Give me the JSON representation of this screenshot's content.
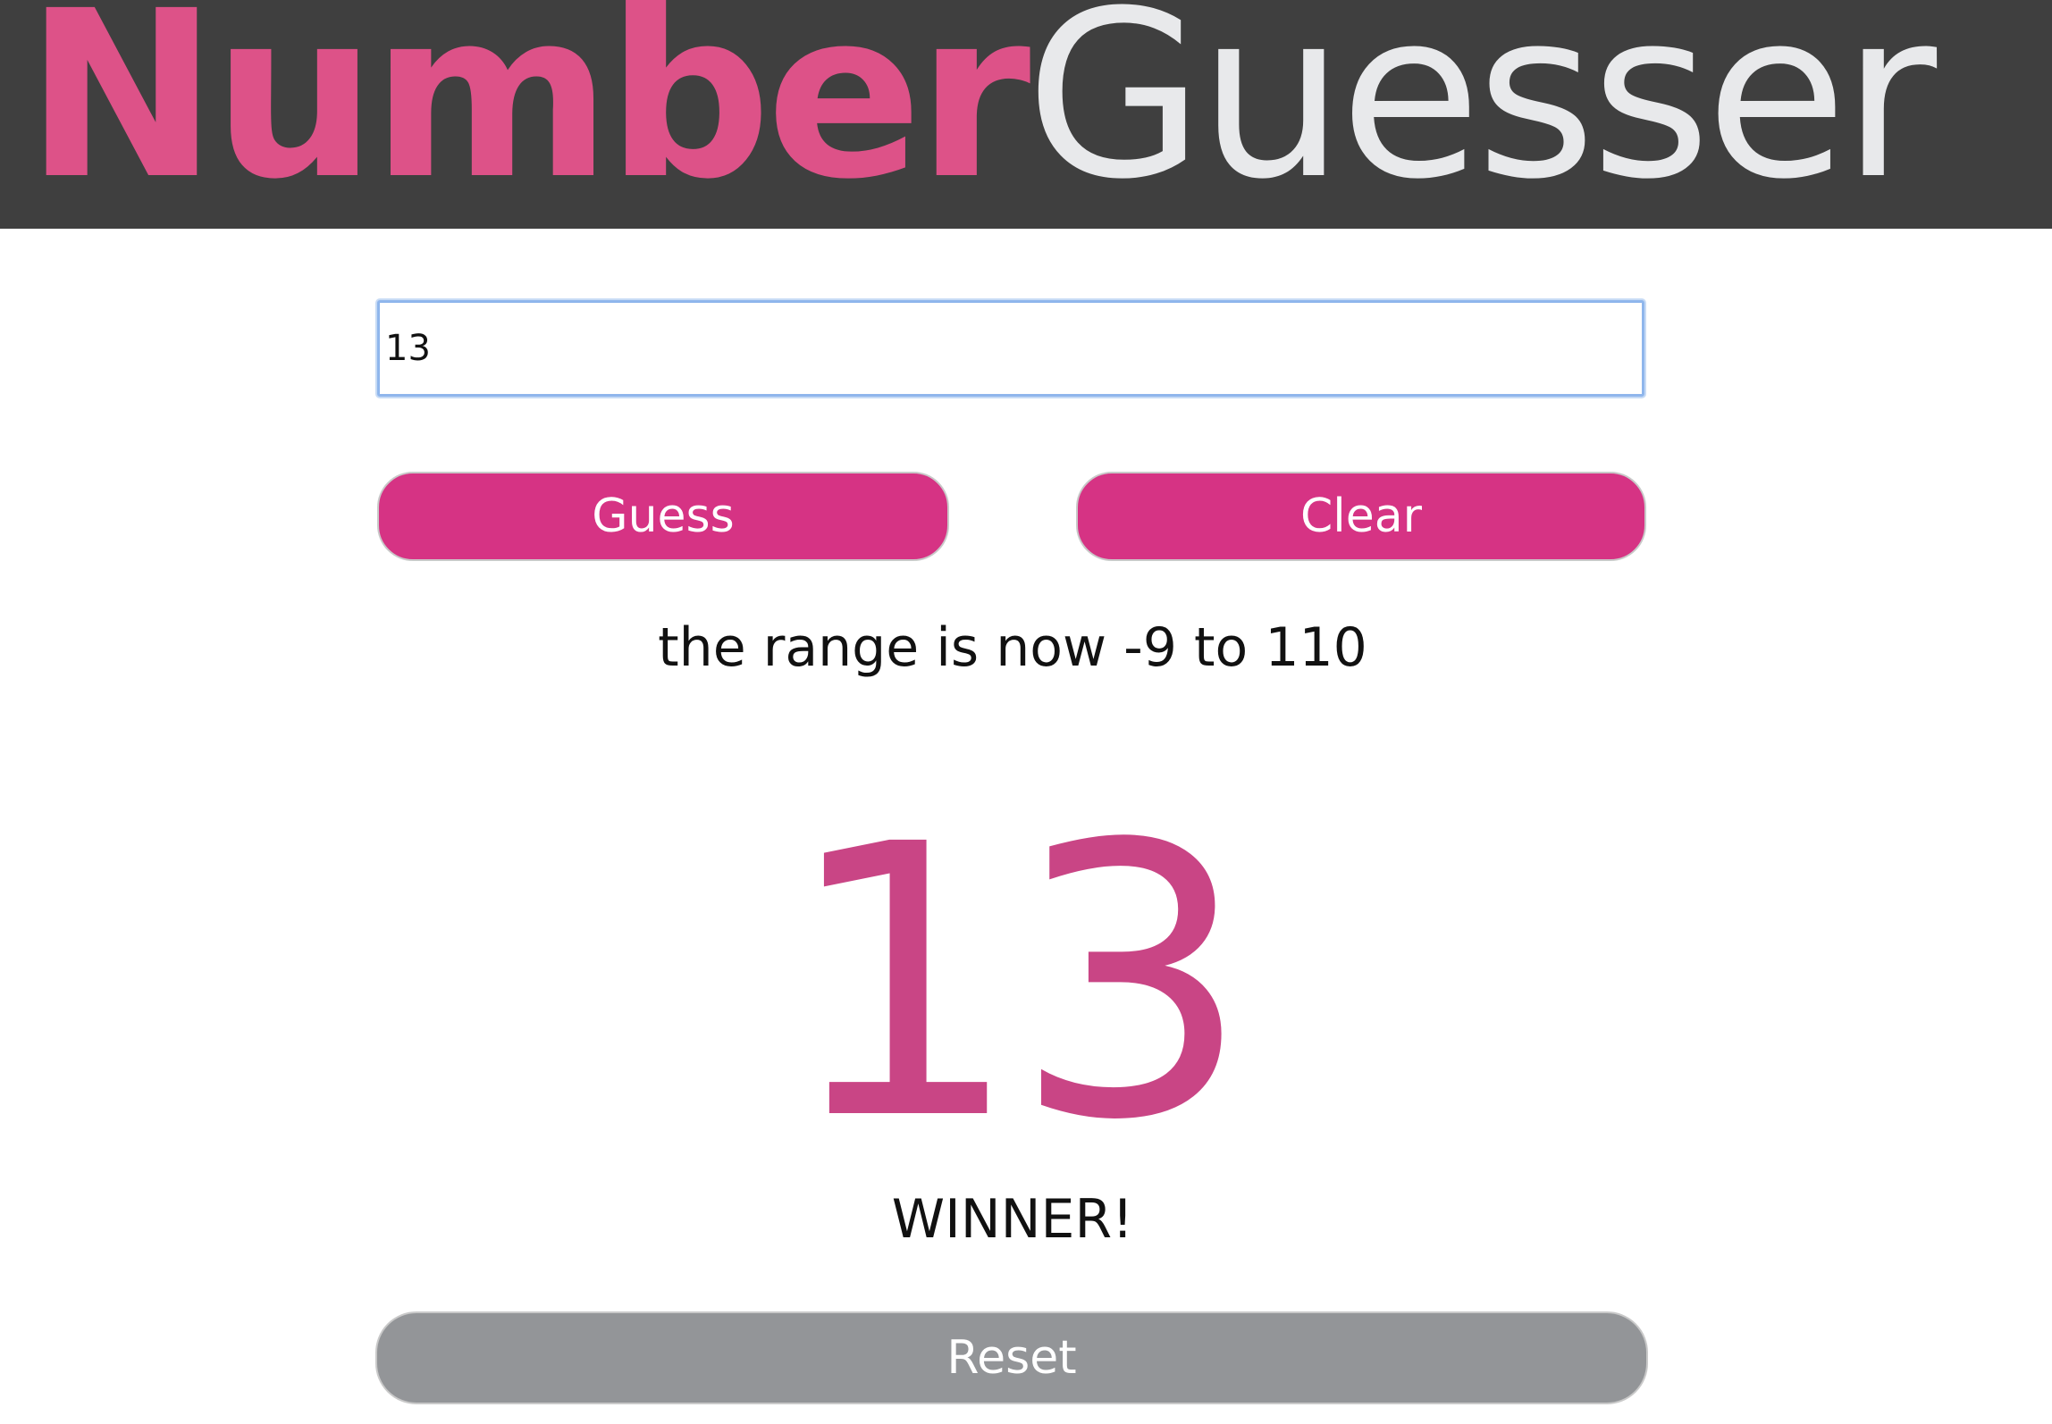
{
  "header": {
    "title_part1": "Number",
    "title_part2": "Guesser"
  },
  "guess_input": {
    "value": "13",
    "placeholder": ""
  },
  "buttons": {
    "guess_label": "Guess",
    "clear_label": "Clear",
    "reset_label": "Reset"
  },
  "feedback": {
    "range_message": "the range is now -9 to 110",
    "last_guess": "13",
    "result": "WINNER!"
  },
  "colors": {
    "header_bg": "#3f3f3f",
    "brand_pink": "#dd5288",
    "title_light": "#e8e9eb",
    "button_pink": "#d63384",
    "guess_number_pink": "#c94585",
    "reset_gray": "#939598"
  }
}
